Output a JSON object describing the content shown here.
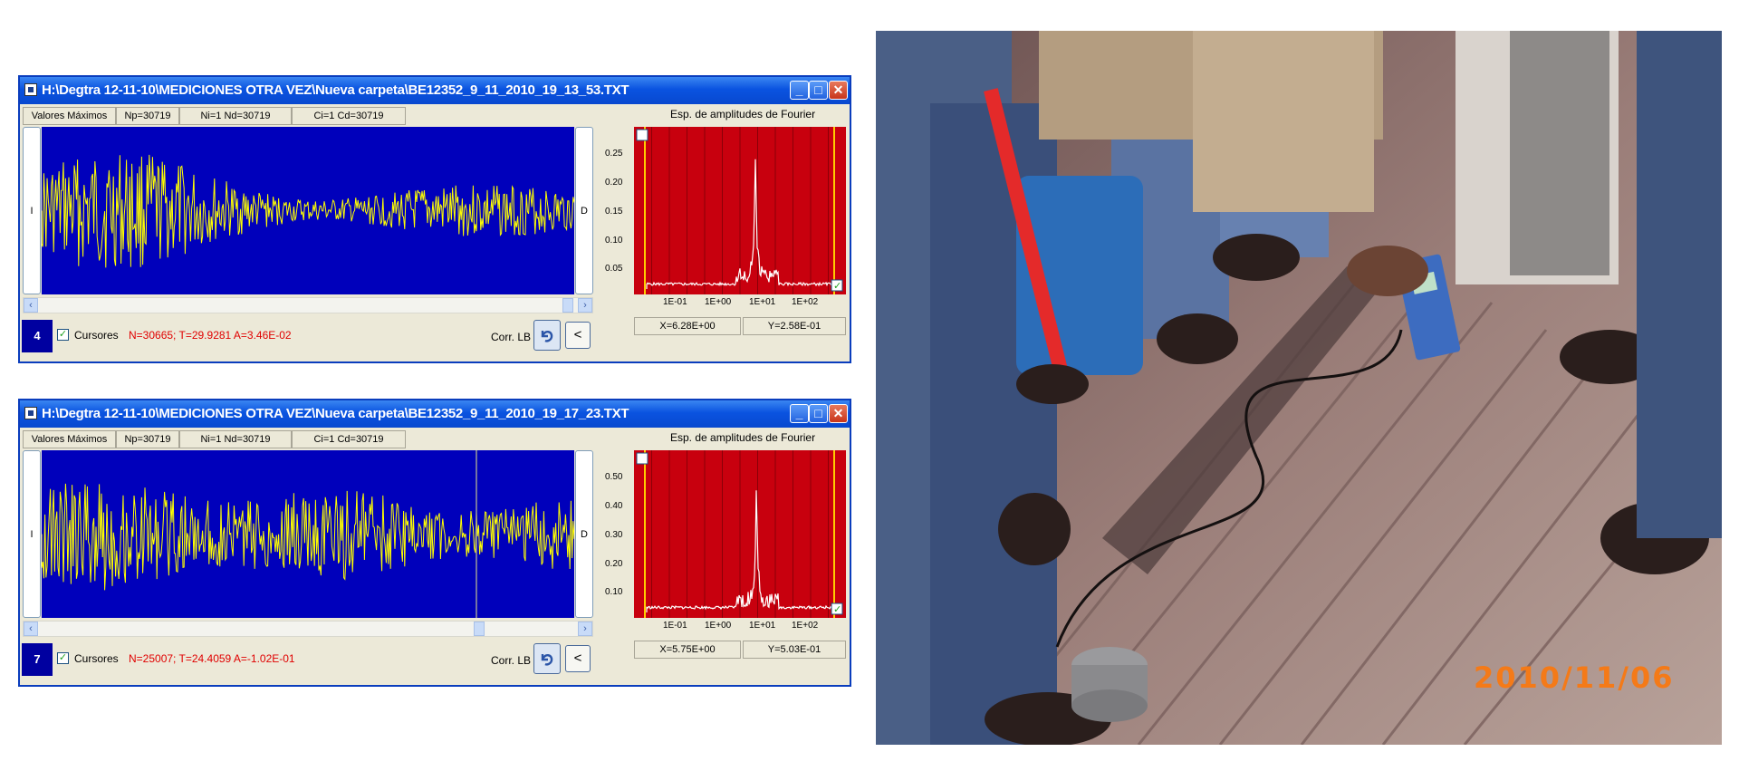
{
  "windows": [
    {
      "title": "H:\\Degtra 12-11-10\\MEDICIONES OTRA VEZ\\Nueva carpeta\\BE12352_9_11_2010_19_13_53.TXT",
      "info": [
        "Valores Máximos",
        "Np=30719",
        "Ni=1 Nd=30719",
        "Ci=1 Cd=30719"
      ],
      "side_left": "I",
      "side_right": "D",
      "fft_title": "Esp. de amplitudes de Fourier",
      "yticks": [
        "0.25",
        "0.20",
        "0.15",
        "0.10",
        "0.05"
      ],
      "xticks": [
        "1E-01",
        "1E+00",
        "1E+01",
        "1E+02"
      ],
      "channel": "4",
      "cursores_label": "Cursores",
      "stats": "N=30665; T=29.9281  A=3.46E-02",
      "corr_label": "Corr. LB",
      "back_label": "<",
      "readout_x": "X=6.28E+00",
      "readout_y": "Y=2.58E-01"
    },
    {
      "title": "H:\\Degtra 12-11-10\\MEDICIONES OTRA VEZ\\Nueva carpeta\\BE12352_9_11_2010_19_17_23.TXT",
      "info": [
        "Valores Máximos",
        "Np=30719",
        "Ni=1 Nd=30719",
        "Ci=1 Cd=30719"
      ],
      "side_left": "I",
      "side_right": "D",
      "fft_title": "Esp. de amplitudes de Fourier",
      "yticks": [
        "0.50",
        "0.40",
        "0.30",
        "0.20",
        "0.10"
      ],
      "xticks": [
        "1E-01",
        "1E+00",
        "1E+01",
        "1E+02"
      ],
      "channel": "7",
      "cursores_label": "Cursores",
      "stats": "N=25007; T=24.4059  A=-1.02E-01",
      "corr_label": "Corr. LB",
      "back_label": "<",
      "readout_x": "X=5.75E+00",
      "readout_y": "Y=5.03E-01"
    }
  ],
  "photo": {
    "date_stamp": "2010/11/06"
  },
  "colors": {
    "waveform_bg": "#0000bb",
    "waveform_line": "#ffff00",
    "fft_bg": "#c8000e",
    "fft_line": "#ffffff",
    "fft_marker": "#ffcc00",
    "stats_text": "#e00000",
    "date_stamp": "#f47a18"
  }
}
